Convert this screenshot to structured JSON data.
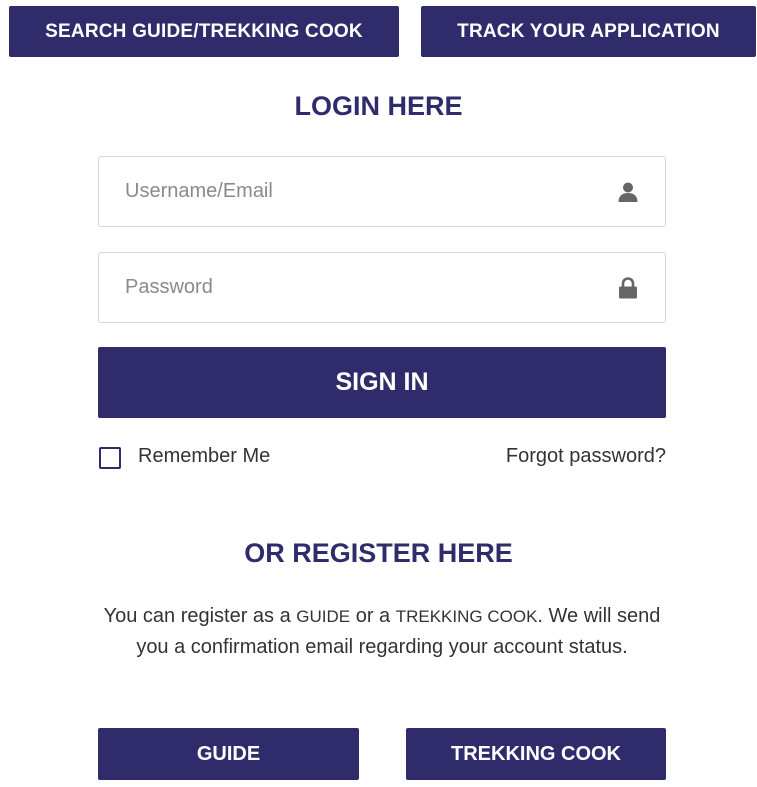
{
  "top_nav": {
    "search_label": "SEARCH GUIDE/TREKKING COOK",
    "track_label": "TRACK YOUR APPLICATION"
  },
  "login": {
    "title": "LOGIN HERE",
    "username_placeholder": "Username/Email",
    "username_icon": "user-icon",
    "password_placeholder": "Password",
    "password_icon": "lock-icon",
    "signin_label": "SIGN IN",
    "remember_label": "Remember Me",
    "remember_checked": false,
    "forgot_label": "Forgot password?"
  },
  "register": {
    "title": "OR REGISTER HERE",
    "text_part1": "You can register as a ",
    "text_guide": "GUIDE",
    "text_part2": " or a ",
    "text_cook": "TREKKING COOK",
    "text_part3": ". We will send you a confirmation email regarding your account status.",
    "guide_label": "GUIDE",
    "cook_label": "TREKKING COOK"
  },
  "colors": {
    "primary": "#302c6b",
    "border": "#d6d6d6",
    "text": "#333333",
    "placeholder": "#8a8a8a",
    "icon": "#666666"
  }
}
